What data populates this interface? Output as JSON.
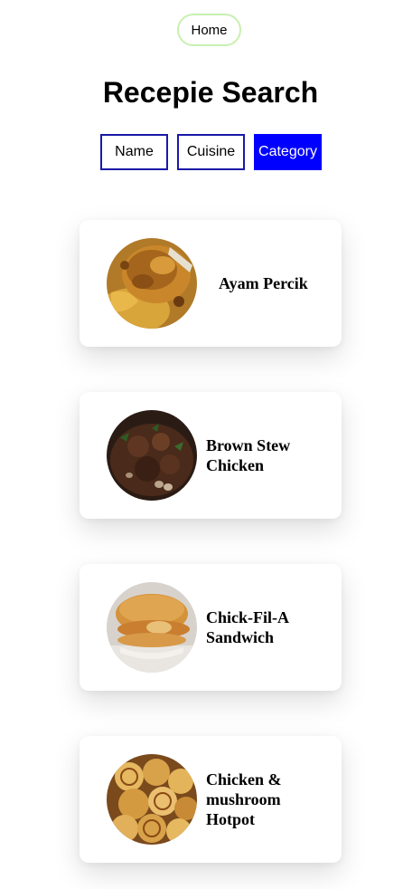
{
  "nav": {
    "home_label": "Home"
  },
  "page_title": "Recepie Search",
  "filters": [
    {
      "label": "Name",
      "active": false
    },
    {
      "label": "Cuisine",
      "active": false
    },
    {
      "label": "Category",
      "active": true
    }
  ],
  "colors": {
    "accent": "#0000ff",
    "filter_border": "#1a1aa8",
    "home_border": "#c8f0b0"
  },
  "recipes": [
    {
      "name": "Ayam Percik",
      "image": "grilled-chicken-photo"
    },
    {
      "name": "Brown Stew Chicken",
      "image": "stew-chicken-photo"
    },
    {
      "name": "Chick-Fil-A Sandwich",
      "image": "chicken-sandwich-photo"
    },
    {
      "name": "Chicken & mushroom Hotpot",
      "image": "hotpot-photo"
    }
  ]
}
